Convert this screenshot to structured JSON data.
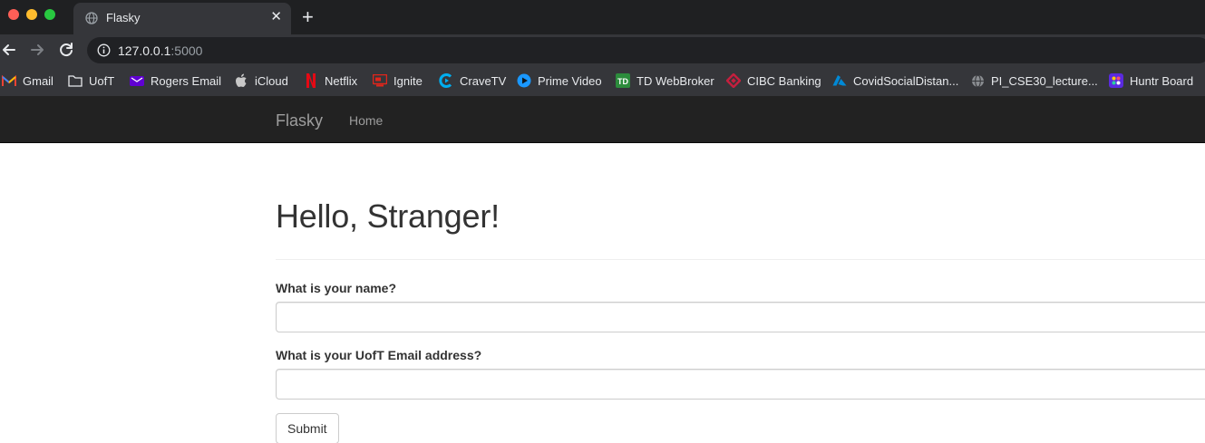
{
  "browser": {
    "tab": {
      "title": "Flasky",
      "icon": "globe-icon",
      "close_label": "✕"
    },
    "new_tab_label": "+",
    "address": {
      "host": "127.0.0.1",
      "port": ":5000"
    },
    "bookmarks": [
      {
        "label": "Gmail",
        "icon": "gmail-icon"
      },
      {
        "label": "UofT",
        "icon": "folder-icon"
      },
      {
        "label": "Rogers Email",
        "icon": "rogers-icon"
      },
      {
        "label": "iCloud",
        "icon": "apple-icon"
      },
      {
        "label": "Netflix",
        "icon": "netflix-icon"
      },
      {
        "label": "Ignite",
        "icon": "ignite-icon"
      },
      {
        "label": "CraveTV",
        "icon": "crave-icon"
      },
      {
        "label": "Prime Video",
        "icon": "prime-video-icon"
      },
      {
        "label": "TD WebBroker",
        "icon": "td-icon"
      },
      {
        "label": "CIBC Banking",
        "icon": "cibc-icon"
      },
      {
        "label": "CovidSocialDistan...",
        "icon": "azure-icon"
      },
      {
        "label": "PI_CSE30_lecture...",
        "icon": "globe-icon"
      },
      {
        "label": "Huntr Board",
        "icon": "huntr-icon"
      }
    ]
  },
  "navbar": {
    "brand": "Flasky",
    "links": [
      "Home"
    ]
  },
  "page": {
    "heading": "Hello, Stranger!",
    "form": {
      "name_label": "What is your name?",
      "name_value": "",
      "email_label": "What is your UofT Email address?",
      "email_value": "",
      "submit_label": "Submit"
    }
  },
  "colors": {
    "chrome_dark": "#1f2022",
    "chrome_toolbar": "#35363a",
    "navbar_bg": "#222222",
    "navbar_text": "#9d9d9d",
    "heading_text": "#333333"
  }
}
